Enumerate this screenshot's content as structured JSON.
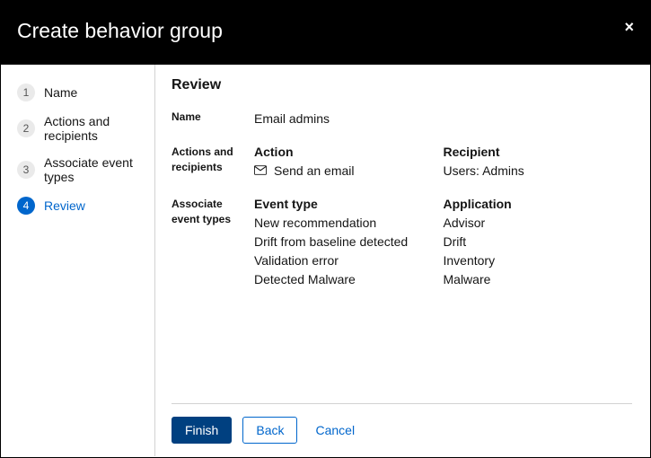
{
  "modal": {
    "title": "Create behavior group",
    "close_label": "×"
  },
  "wizard": {
    "steps": [
      {
        "num": "1",
        "label": "Name"
      },
      {
        "num": "2",
        "label": "Actions and recipients"
      },
      {
        "num": "3",
        "label": "Associate event types"
      },
      {
        "num": "4",
        "label": "Review"
      }
    ],
    "active_index": 3
  },
  "content": {
    "title": "Review",
    "name_row": {
      "label": "Name",
      "value": "Email admins"
    },
    "actions_row": {
      "label": "Actions and recipients",
      "action_heading": "Action",
      "action_value": "Send an email",
      "recipient_heading": "Recipient",
      "recipient_value": "Users: Admins"
    },
    "events_row": {
      "label": "Associate event types",
      "event_heading": "Event type",
      "event_values": [
        "New recommendation",
        "Drift from baseline detected",
        "Validation error",
        "Detected Malware"
      ],
      "app_heading": "Application",
      "app_values": [
        "Advisor",
        "Drift",
        "Inventory",
        "Malware"
      ]
    }
  },
  "footer": {
    "finish": "Finish",
    "back": "Back",
    "cancel": "Cancel"
  }
}
